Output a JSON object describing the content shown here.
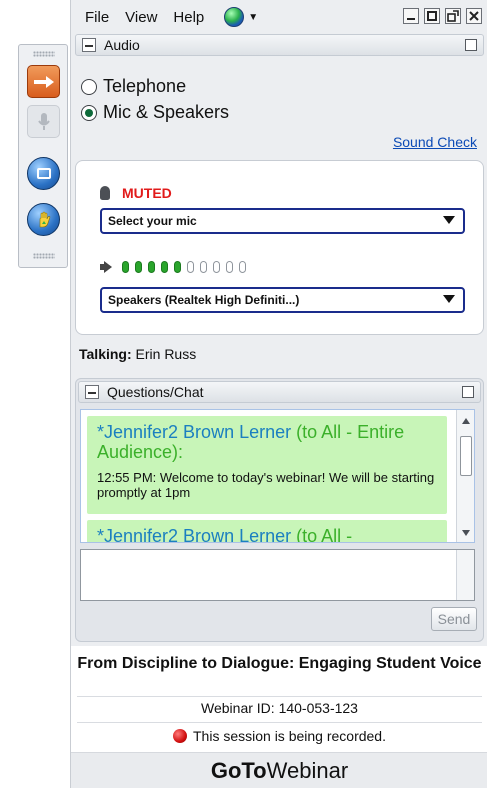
{
  "menu": {
    "items": [
      "File",
      "View",
      "Help"
    ],
    "language_globe_icon": "globe-icon"
  },
  "audio": {
    "header": "Audio",
    "options": [
      {
        "label": "Telephone",
        "selected": false
      },
      {
        "label": "Mic & Speakers",
        "selected": true
      }
    ],
    "sound_check_link": "Sound Check",
    "mic_status": "MUTED",
    "mic_select_value": "Select your mic",
    "volume_level": 5,
    "volume_max": 10,
    "speaker_select_value": "Speakers (Realtek High Definiti...)"
  },
  "talking": {
    "label": "Talking:",
    "name": "Erin Russ"
  },
  "chat": {
    "header": "Questions/Chat",
    "messages": [
      {
        "author": "*Jennifer2 Brown Lerner",
        "scope": "(to All - Entire Audience):",
        "body": "12:55 PM: Welcome to today's webinar!  We will be starting promptly at 1pm"
      },
      {
        "author": "*Jennifer2 Brown Lerner",
        "scope": "(to All -",
        "body": ""
      }
    ],
    "send_button": "Send"
  },
  "footer": {
    "title": "From Discipline to Dialogue: Engaging Student Voice",
    "webinar_id": "Webinar ID: 140-053-123",
    "recording_notice": "This session is being recorded.",
    "brand_primary": "GoTo",
    "brand_secondary": "Webinar"
  },
  "colors": {
    "muted_red": "#e11b1b",
    "link_blue": "#0b4ab6",
    "chat_bg": "#c8f5b8",
    "chat_author": "#1b7fc0",
    "chat_scope": "#3bb02a",
    "volume_on": "#2aa52c"
  }
}
